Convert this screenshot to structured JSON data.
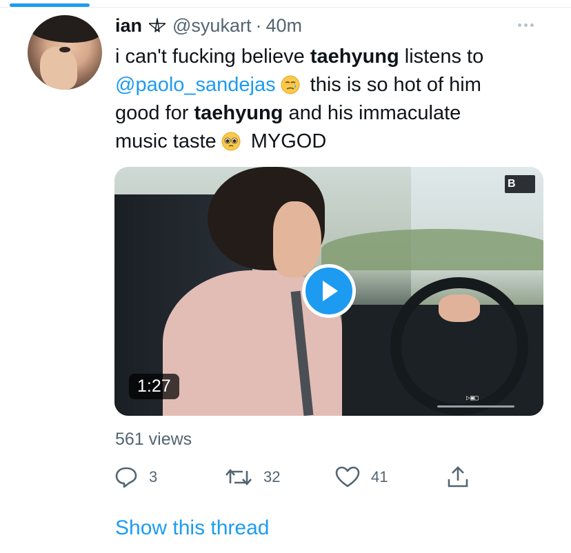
{
  "tweet": {
    "author": {
      "name": "ian",
      "badge_icon": "pentagram-icon",
      "handle": "@syukart",
      "separator": "·",
      "time": "40m"
    },
    "text": {
      "line1_a": "i can't fucking believe ",
      "line1_bold": "taehyung",
      "line1_b": " listens to",
      "line2_mention": "@paolo_sandejas",
      "line2_emoji": "face-holding-back-tears-emoji",
      "line2_b": "this is so hot of him",
      "line3_a": "good for ",
      "line3_bold": "taehyung",
      "line3_b": " and his immaculate",
      "line4_a": "music taste",
      "line4_emoji": "pleading-face-emoji",
      "line4_b": "MYGOD"
    },
    "media": {
      "duration": "1:27",
      "brand_text": "B",
      "overlay_text": "▷▣▢"
    },
    "views": "561 views",
    "actions": {
      "reply_count": "3",
      "retweet_count": "32",
      "like_count": "41"
    },
    "show_thread": "Show this thread"
  },
  "colors": {
    "accent": "#1d9bf0",
    "secondary_text": "#536471",
    "primary_text": "#0f1419"
  }
}
